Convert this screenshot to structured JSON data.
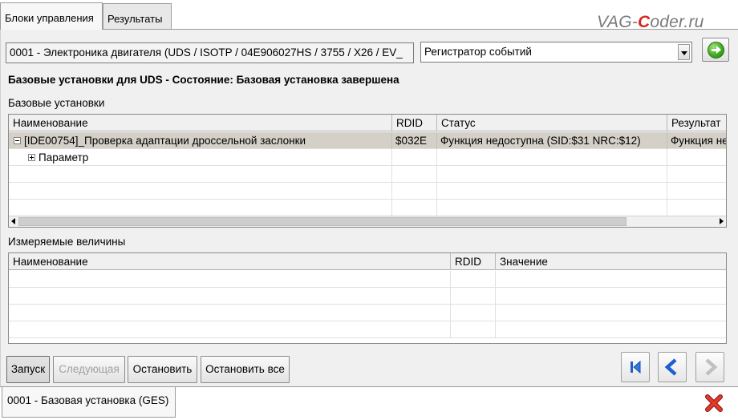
{
  "tabs": [
    {
      "label": "Блоки управления",
      "active": true
    },
    {
      "label": "Результаты",
      "active": false
    }
  ],
  "logo": {
    "prefix": "VAG-",
    "highlight": "C",
    "suffix": "oder.ru",
    "accent_color": "#d8261d"
  },
  "header": {
    "ecu_field": "0001 - Электроника двигателя  (UDS / ISOTP / 04E906027HS / 3755 / X26 / EV_",
    "mode_select": "Регистратор событий",
    "go_button_icon": "green-arrow-right-icon"
  },
  "status_text": "Базовые установки для UDS - Состояние: Базовая установка завершена",
  "basic_settings": {
    "section_label": "Базовые установки",
    "columns": [
      "Наименование",
      "RDID",
      "Статус",
      "Результат"
    ],
    "rows": [
      {
        "name": "[IDE00754]_Проверка адаптации дроссельной заслонки",
        "rdid": "$032E",
        "status": "Функция недоступна (SID:$31 NRC:$12)",
        "result": "Функция не",
        "toggle": "minus",
        "selected": true
      },
      {
        "name": "Параметр",
        "rdid": "",
        "status": "",
        "result": "",
        "toggle": "plus",
        "selected": false
      }
    ]
  },
  "measured_values": {
    "section_label": "Измеряемые величины",
    "columns": [
      "Наименование",
      "RDID",
      "Значение"
    ]
  },
  "buttons": {
    "start": "Запуск",
    "next": "Следующая",
    "stop": "Остановить",
    "stop_all": "Остановить все"
  },
  "nav_icons": [
    "first-page-icon",
    "previous-icon",
    "next-icon"
  ],
  "bottom_tab": {
    "label": "0001 - Базовая установка (GES)"
  },
  "close_icon": "red-x-close-icon"
}
